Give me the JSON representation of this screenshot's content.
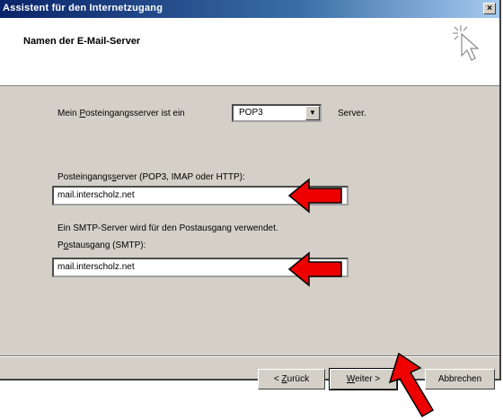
{
  "window": {
    "title": "Assistent für den Internetzugang",
    "close_glyph": "×"
  },
  "header": {
    "title": "Namen der E-Mail-Server",
    "icon": "wizard-cursor-icon"
  },
  "form": {
    "incoming_type_prefix": "Mein ",
    "incoming_type_ul": "P",
    "incoming_type_rest": "osteingangsserver ist ein",
    "server_type_value": "POP3",
    "server_suffix": "Server.",
    "incoming_label_a": "Posteingangs",
    "incoming_label_ul": "s",
    "incoming_label_b": "erver (POP3, IMAP oder HTTP):",
    "incoming_value": "mail.interscholz.net",
    "smtp_note": "Ein SMTP-Server wird für den Postausgang verwendet.",
    "outgoing_label_a": "P",
    "outgoing_label_ul": "o",
    "outgoing_label_b": "stausgang (SMTP):",
    "outgoing_value": "mail.interscholz.net"
  },
  "buttons": {
    "back_a": "< ",
    "back_ul": "Z",
    "back_b": "urück",
    "next_ul": "W",
    "next_b": "eiter >",
    "cancel": "Abbrechen"
  },
  "annotation_color": "#ee0000"
}
